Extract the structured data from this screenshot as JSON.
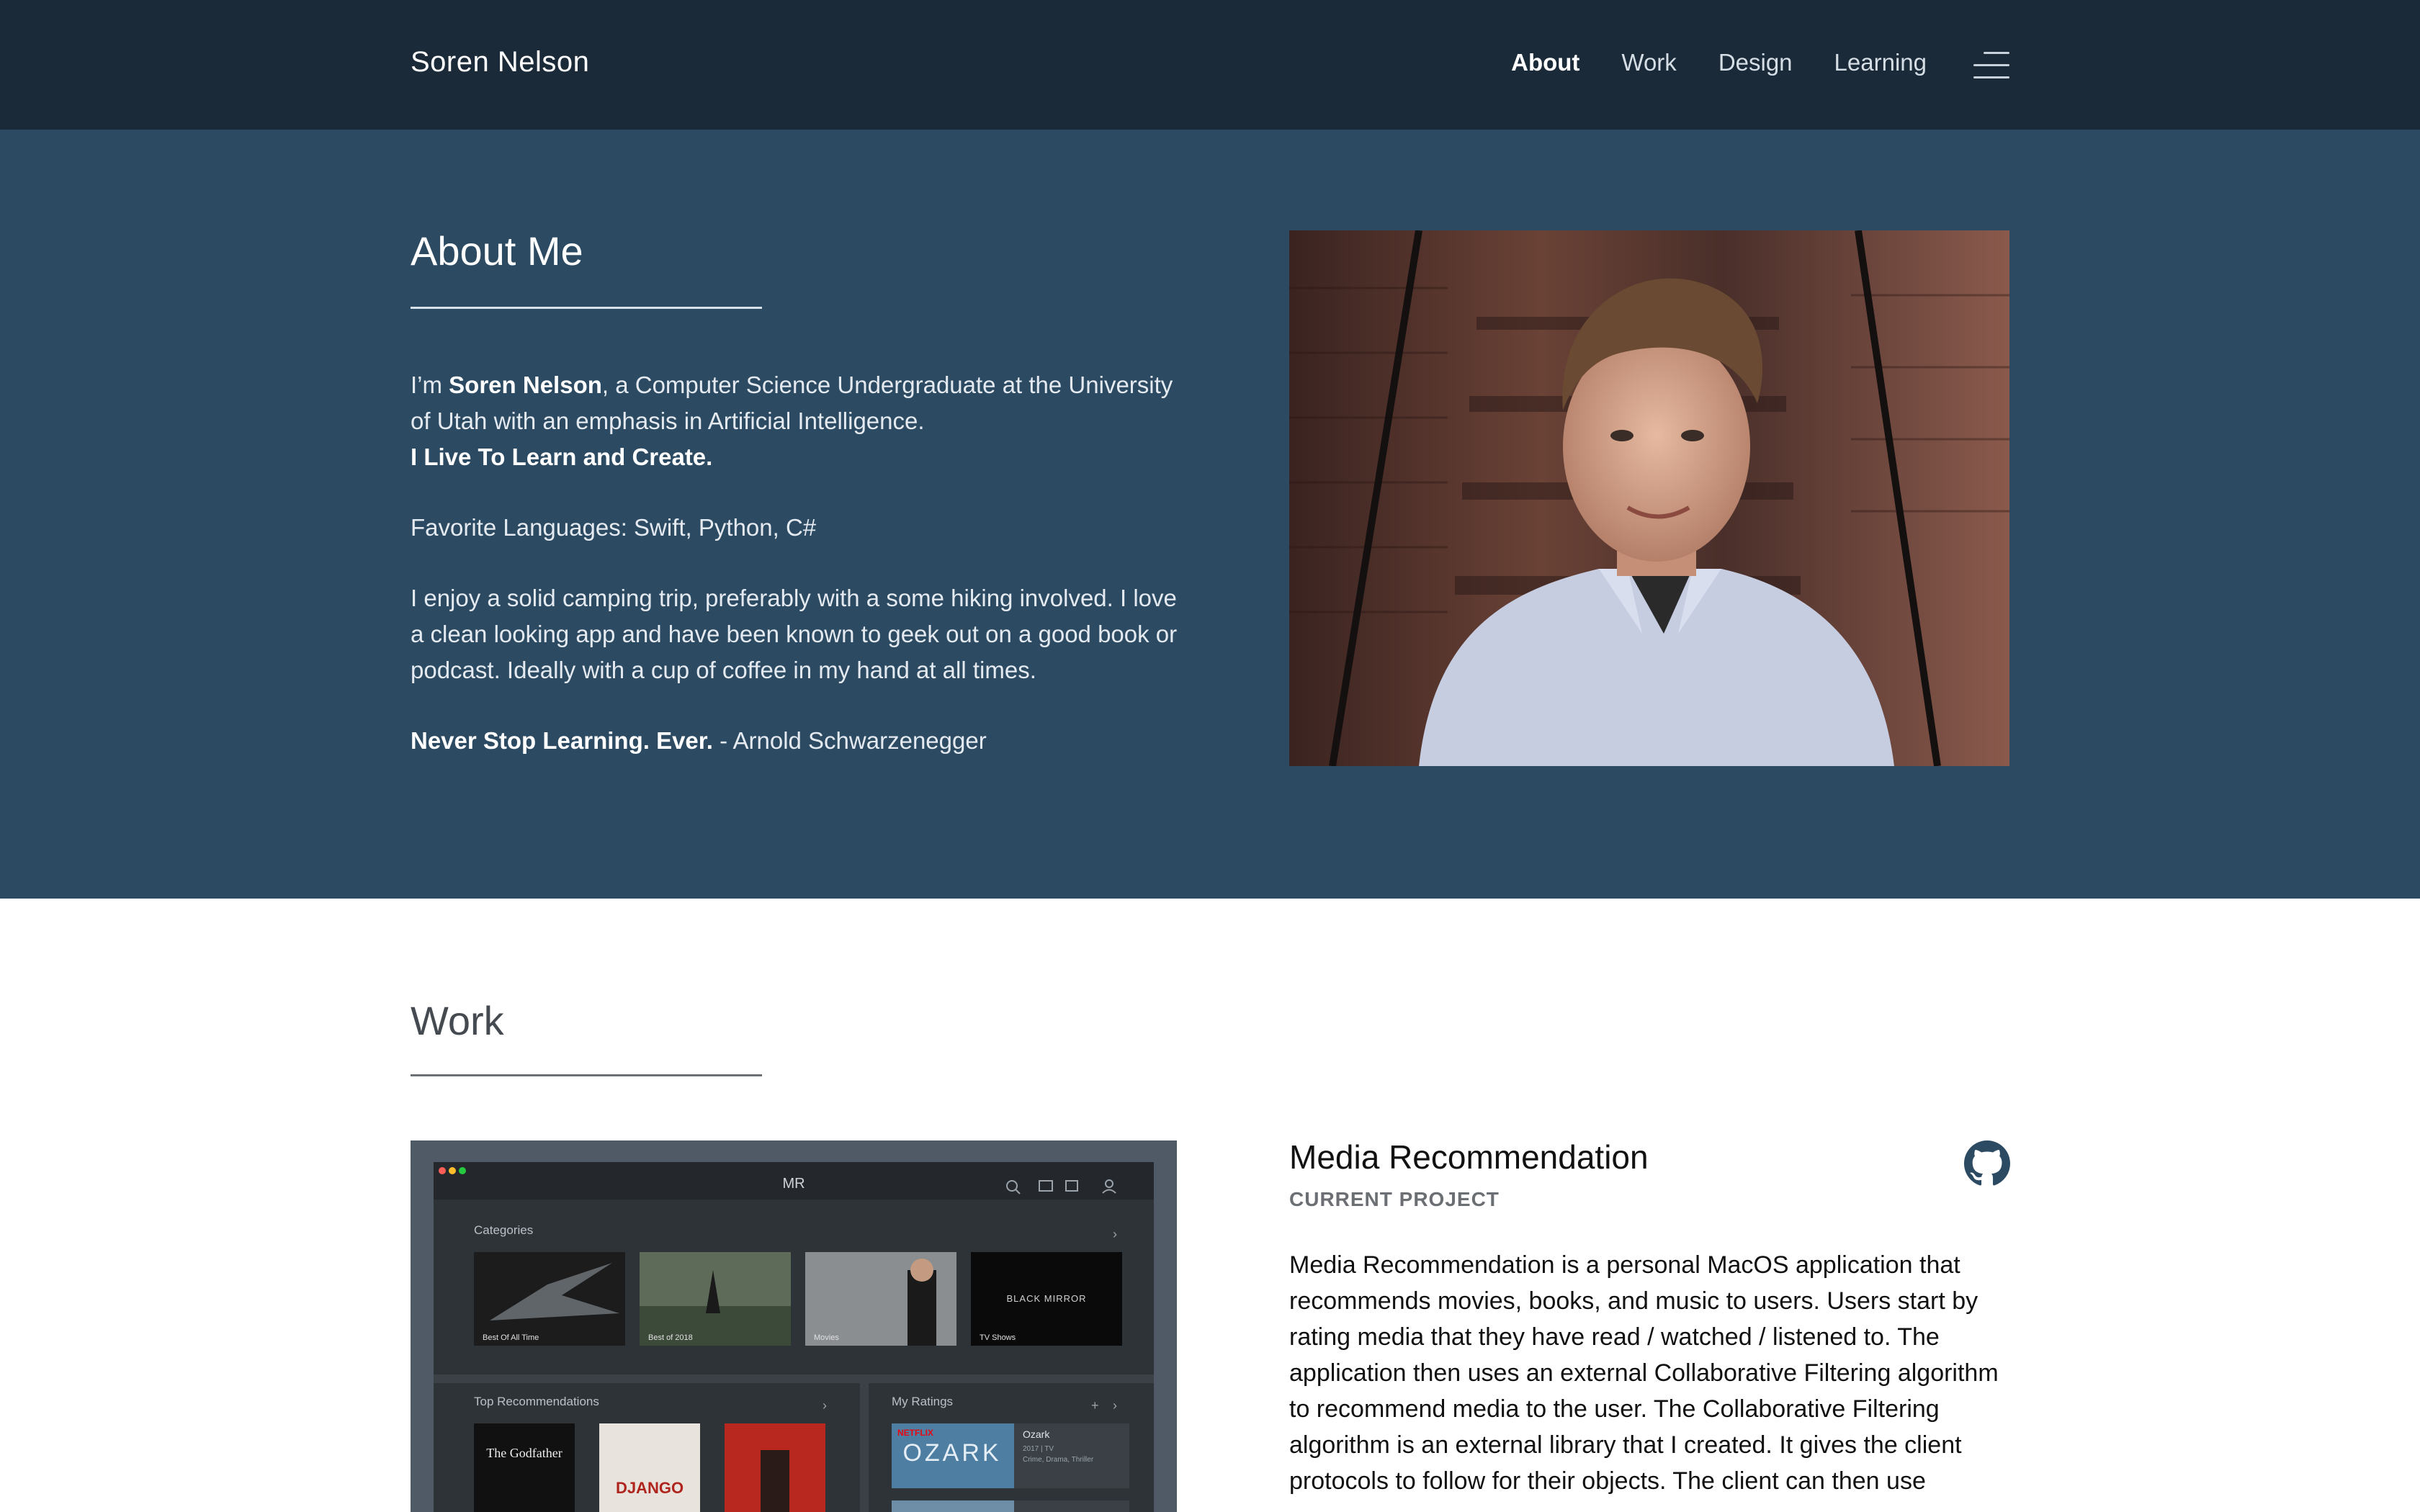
{
  "header": {
    "brand": "Soren Nelson",
    "nav": [
      {
        "label": "About",
        "active": true
      },
      {
        "label": "Work",
        "active": false
      },
      {
        "label": "Design",
        "active": false
      },
      {
        "label": "Learning",
        "active": false
      }
    ],
    "menu_icon": "hamburger-menu-icon"
  },
  "about": {
    "title": "About Me",
    "intro_lead": "I’m ",
    "intro_name": "Soren Nelson",
    "intro_rest": ", a Computer Science Undergraduate at the University of Utah with an emphasis in Artificial Intelligence.",
    "tagline": "I Live To Learn and Create.",
    "languages": "Favorite Languages: Swift, Python, C#",
    "hobbies": "I enjoy a solid camping trip, preferably with a some hiking involved. I love a clean looking app and have been known to geek out on a good book or podcast. Ideally with a cup of coffee in my hand at all times.",
    "quote_bold": "Never Stop Learning. Ever.",
    "quote_author": " - Arnold Schwarzenegger"
  },
  "work": {
    "title": "Work",
    "project": {
      "title": "Media Recommendation",
      "status": "CURRENT PROJECT",
      "description": "Media Recommendation is a personal MacOS application that recommends movies, books, and music to users. Users start by rating media that they have read / watched / listened to. The application then uses an external Collaborative Filtering algorithm to recommend media to the user. The Collaborative Filtering algorithm is an external library that I created. It gives the client protocols to follow for their objects. The client can then use",
      "screenshot": {
        "app_title": "MR",
        "categories_label": "Categories",
        "categories": [
          "Best Of All Time",
          "Best of 2018",
          "Movies",
          "TV Shows"
        ],
        "black_mirror_text": "BLACK MIRROR",
        "top_recs_label": "Top Recommendations",
        "poster_godfather": "The Godfather",
        "poster_django": "DJANGO",
        "my_ratings_label": "My Ratings",
        "rating_item": "Ozark",
        "rating_netflix": "NETFLIX",
        "rating_ozark_logo": "OZARK",
        "rating_meta": "2017 | TV",
        "rating_genre": "Crime, Drama, Thriller"
      }
    }
  },
  "colors": {
    "nav_bg": "#1b2a39",
    "about_bg": "#2c4a62",
    "work_bg": "#ffffff"
  }
}
